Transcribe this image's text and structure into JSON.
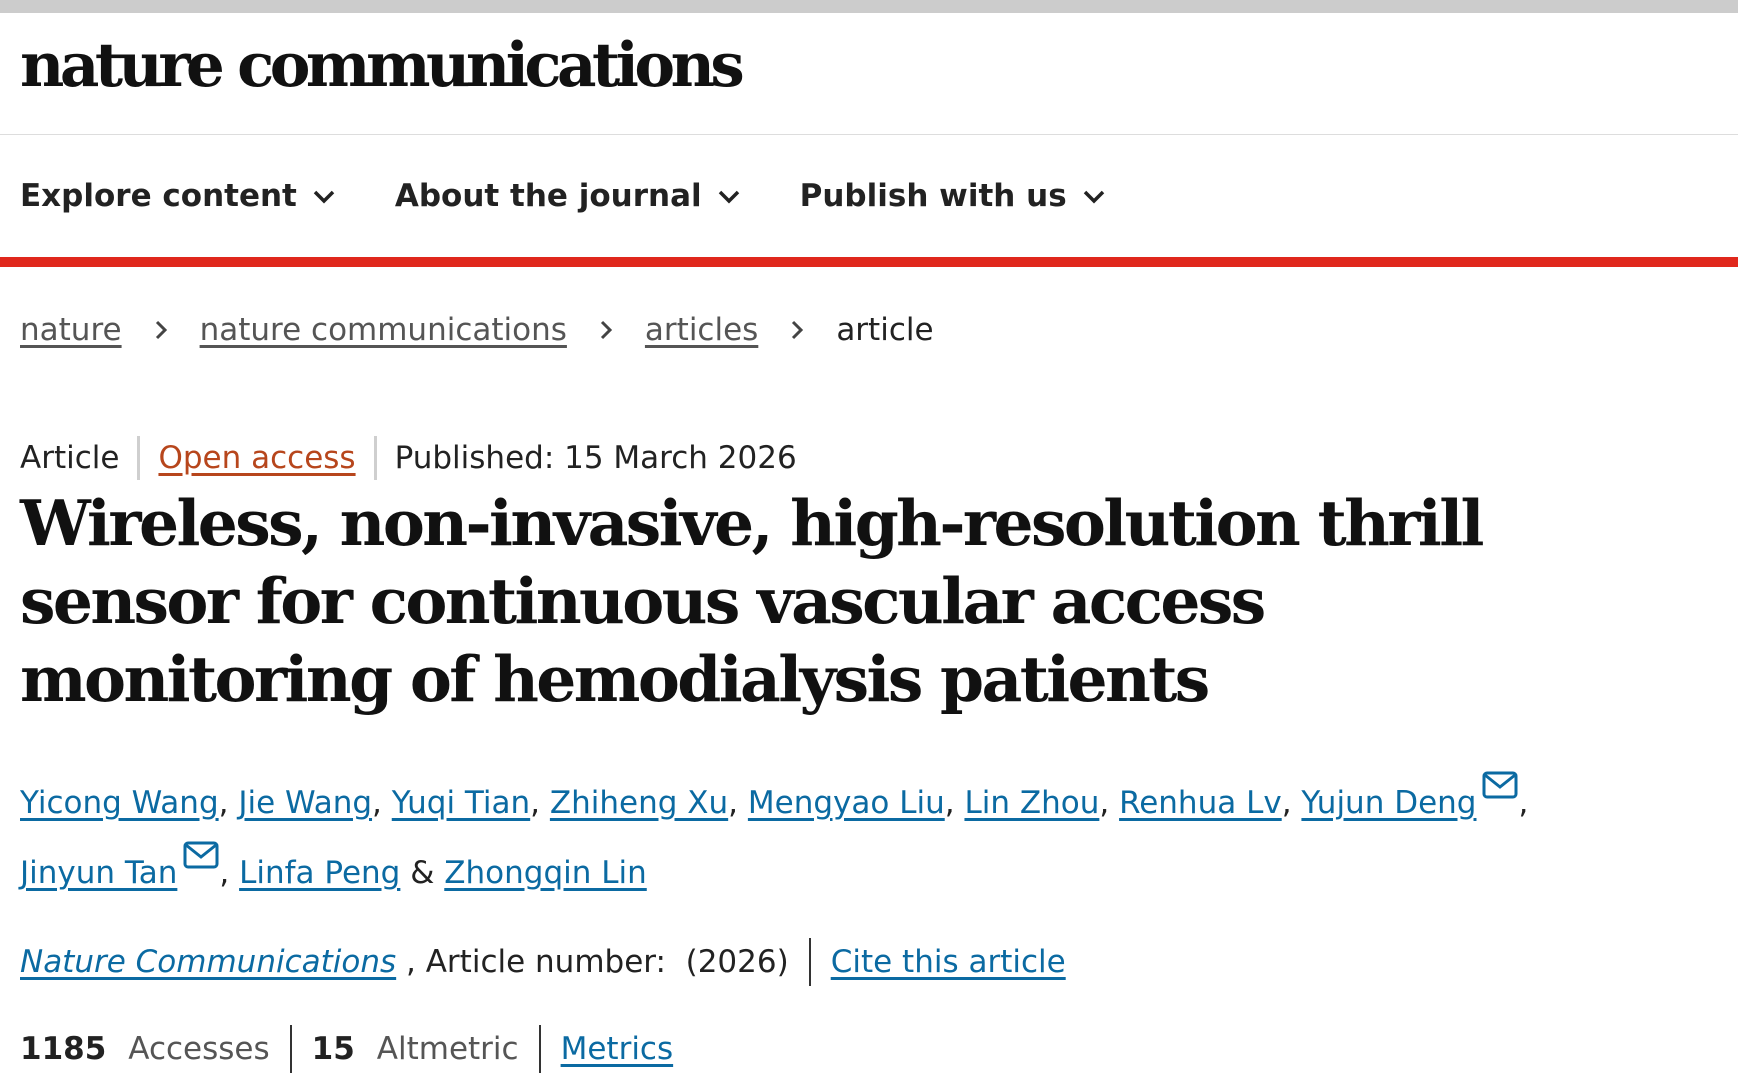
{
  "header": {
    "logo": "nature communications"
  },
  "nav": {
    "items": [
      {
        "label": "Explore content"
      },
      {
        "label": "About the journal"
      },
      {
        "label": "Publish with us"
      }
    ]
  },
  "breadcrumb": {
    "items": [
      "nature",
      "nature communications",
      "articles"
    ],
    "current": "article"
  },
  "article": {
    "type": "Article",
    "open_access": "Open access",
    "published": "Published: 15 March 2026",
    "title": "Wireless, non-invasive, high-resolution thrill sensor for continuous vascular access monitoring of hemodialysis patients",
    "authors": [
      "Yicong Wang",
      "Jie Wang",
      "Yuqi Tian",
      "Zhiheng Xu",
      "Mengyao Liu",
      "Lin Zhou",
      "Renhua Lv",
      "Yujun Deng",
      "Jinyun Tan",
      "Linfa Peng",
      "Zhongqin Lin"
    ],
    "author_separator": ", ",
    "author_last_separator": " & ",
    "journal": "Nature Communications",
    "article_number": " , Article number:  (2026)",
    "cite_label": "Cite this article"
  },
  "metrics": {
    "accesses_value": "1185",
    "accesses_label": "Accesses",
    "altmetric_value": "15",
    "altmetric_label": "Altmetric",
    "metrics_link": "Metrics"
  },
  "colors": {
    "link": "#0b6aa2",
    "open_access": "#b7461c",
    "accent_bar": "#e0281c"
  }
}
